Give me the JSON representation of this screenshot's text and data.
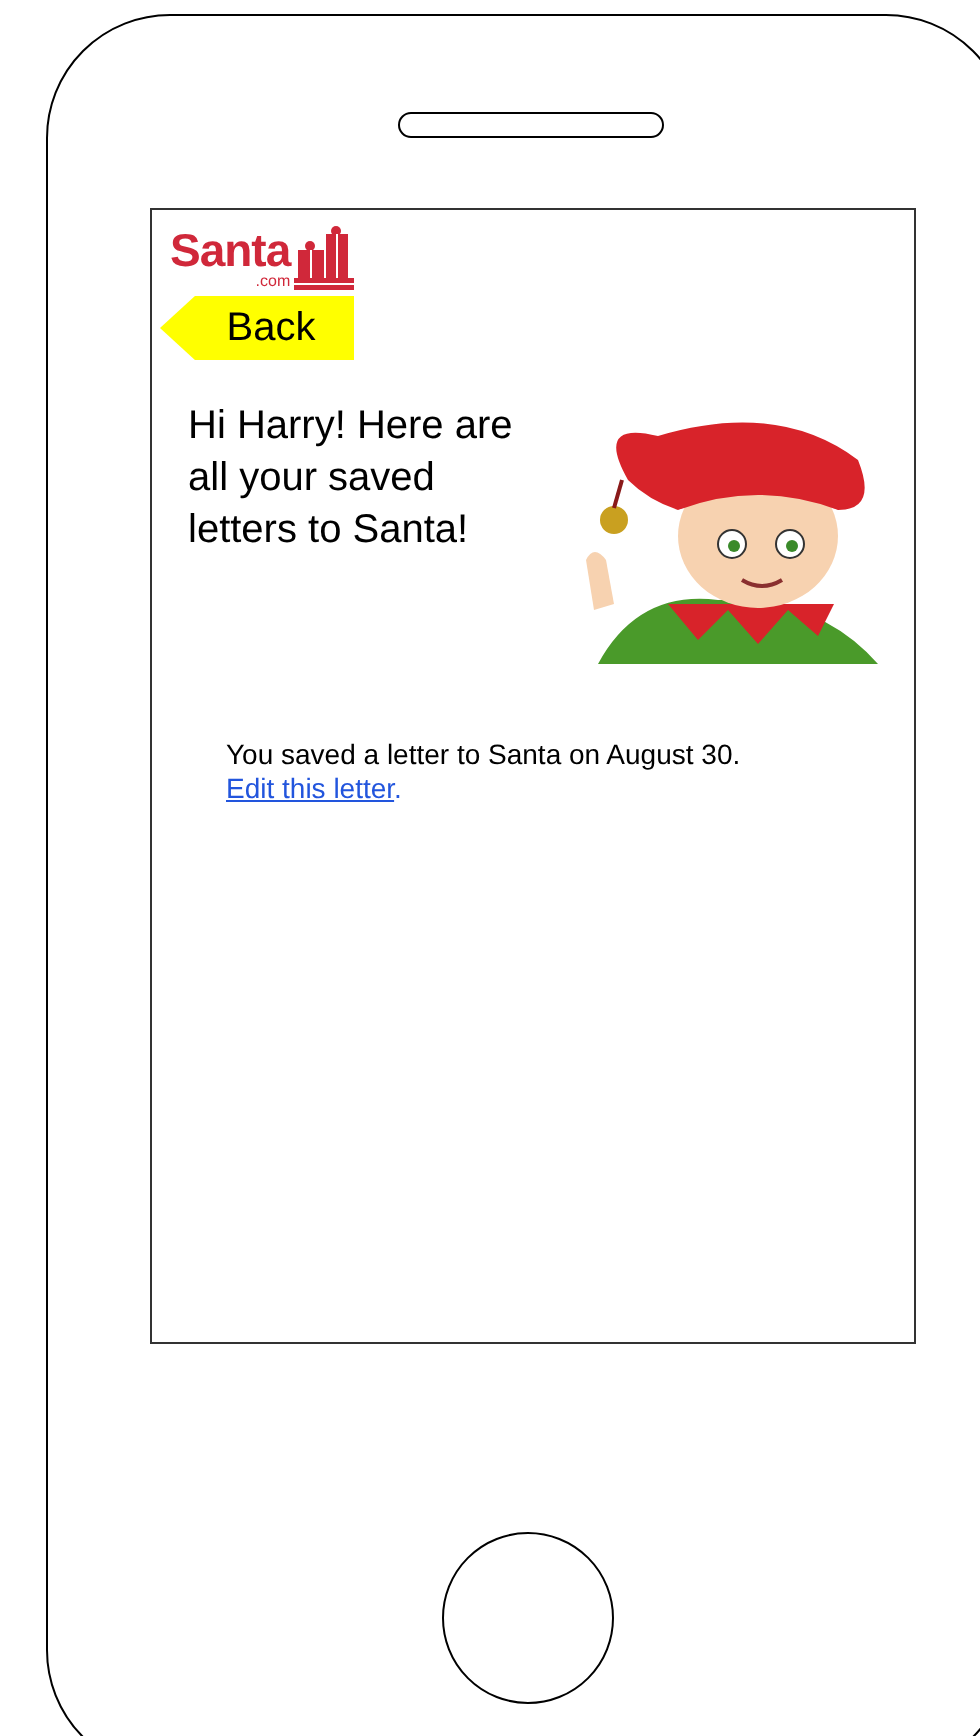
{
  "logo": {
    "name": "Santa",
    "domain": ".com"
  },
  "back_button": {
    "label": "Back"
  },
  "greeting": "Hi Harry! Here are all your saved letters to Santa!",
  "saved_letters": [
    {
      "text": "You saved a letter to Santa on August 30.",
      "link": "Edit this letter",
      "after_link": "."
    }
  ]
}
